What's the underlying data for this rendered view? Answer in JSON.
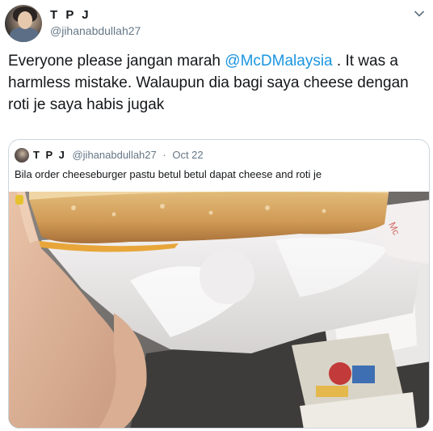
{
  "author": {
    "name": "T P J",
    "handle": "@jihanabdullah27"
  },
  "tweet": {
    "text_before": "Everyone please jangan marah ",
    "mention": "@McDMalaysia",
    "text_after": " . It was a harmless mistake. Walaupun dia bagi saya cheese dengan roti je saya habis jugak"
  },
  "quoted_tweet": {
    "name": "T P J",
    "handle": "@jihanabdullah27",
    "separator": "·",
    "date": "Oct 22",
    "text": "Bila order cheeseburger pastu betul betul dapat cheese and roti je"
  },
  "icons": {
    "menu": "chevron-down-icon"
  },
  "colors": {
    "link": "#1b95e0",
    "secondary_text": "#657786",
    "border": "#ccd6dd"
  }
}
